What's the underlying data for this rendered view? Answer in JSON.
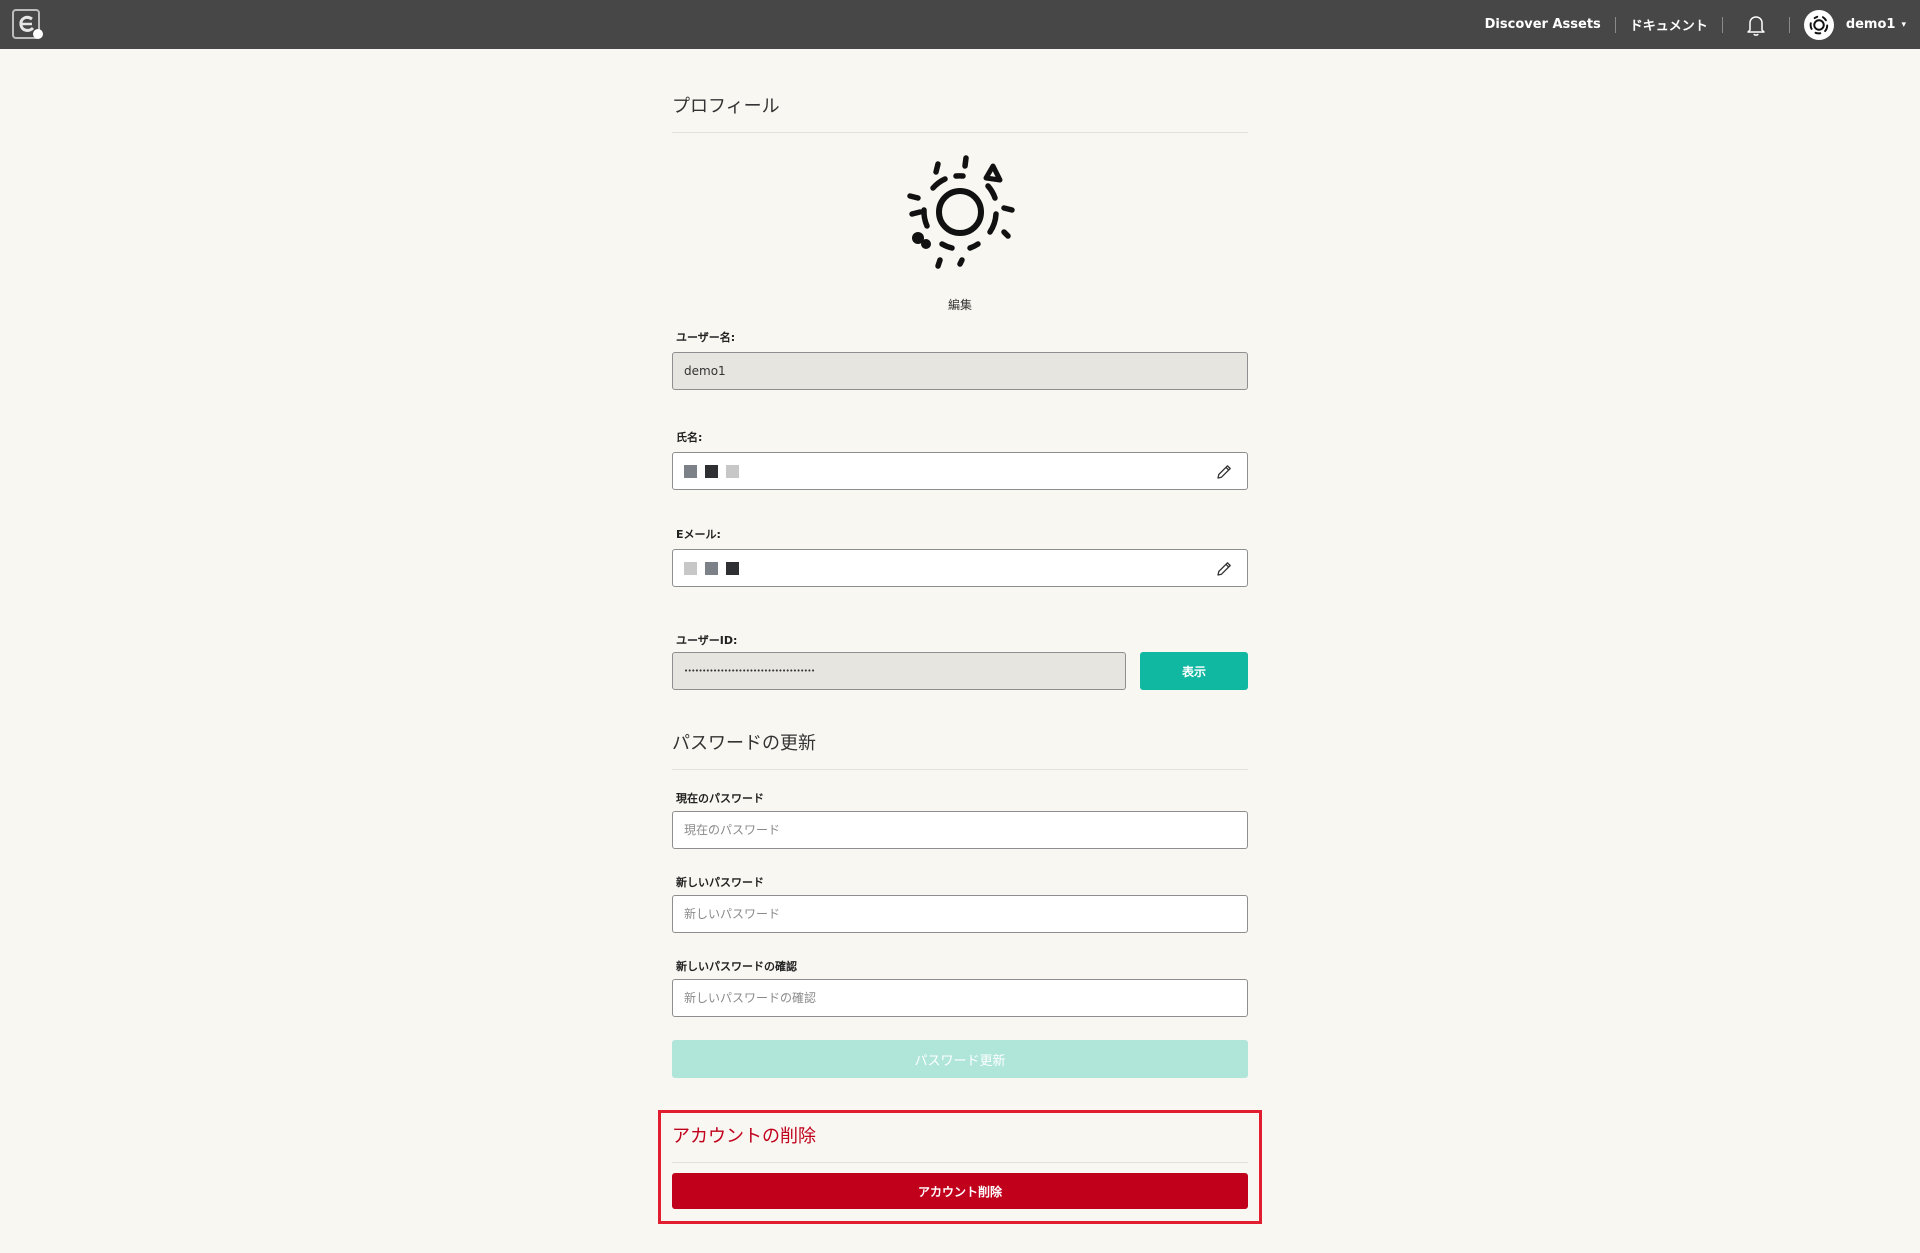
{
  "header": {
    "logo_icon": "app-logo-icon",
    "links": {
      "discover": "Discover Assets",
      "docs": "ドキュメント"
    },
    "notification_icon": "bell-icon",
    "user": {
      "name": "demo1",
      "avatar_icon": "sun-avatar-icon",
      "caret": "▾"
    }
  },
  "profile": {
    "title": "プロフィール",
    "avatar_icon": "sun-avatar-icon",
    "edit_label": "編集",
    "username": {
      "label": "ユーザー名:",
      "value": "demo1"
    },
    "full_name": {
      "label": "氏名:",
      "swatches": [
        "#7c8188",
        "#2e2f33",
        "#c7c7c7"
      ],
      "edit_icon": "pencil-icon"
    },
    "email": {
      "label": "Eメール:",
      "swatches": [
        "#c7c7c7",
        "#7c8188",
        "#2e2f33"
      ],
      "edit_icon": "pencil-icon"
    },
    "user_id": {
      "label": "ユーザーID:",
      "value": "••••••••••••••••••••••••••••••••••••",
      "show_button": "表示"
    }
  },
  "password": {
    "title": "パスワードの更新",
    "current": {
      "label": "現在のパスワード",
      "placeholder": "現在のパスワード"
    },
    "new": {
      "label": "新しいパスワード",
      "placeholder": "新しいパスワード"
    },
    "confirm": {
      "label": "新しいパスワードの確認",
      "placeholder": "新しいパスワードの確認"
    },
    "submit": "パスワード更新"
  },
  "danger": {
    "title": "アカウントの削除",
    "button": "アカウント削除"
  },
  "colors": {
    "topbar": "#474747",
    "accent": "#10b7a1",
    "accent_disabled": "#b0e6da",
    "danger": "#c1001c",
    "danger_outline": "#e01e2f"
  }
}
